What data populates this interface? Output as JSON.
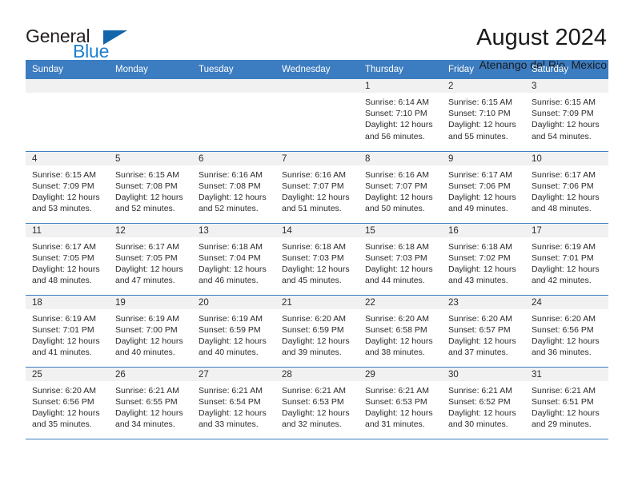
{
  "brand": {
    "name_part1": "General",
    "name_part2": "Blue",
    "triangle_icon": "brand-triangle-icon"
  },
  "header": {
    "title": "August 2024",
    "subtitle": "Atenango del Rio, Mexico"
  },
  "colors": {
    "header_blue": "#3c7cc0",
    "brand_blue": "#1c7fd1",
    "triangle_blue": "#1165aa",
    "daynum_bg": "#f1f1f1",
    "text": "#2b2b2b"
  },
  "weekdays": [
    "Sunday",
    "Monday",
    "Tuesday",
    "Wednesday",
    "Thursday",
    "Friday",
    "Saturday"
  ],
  "weeks": [
    [
      {
        "day": "",
        "empty": true,
        "sunrise": "",
        "sunset": "",
        "daylight": ""
      },
      {
        "day": "",
        "empty": true,
        "sunrise": "",
        "sunset": "",
        "daylight": ""
      },
      {
        "day": "",
        "empty": true,
        "sunrise": "",
        "sunset": "",
        "daylight": ""
      },
      {
        "day": "",
        "empty": true,
        "sunrise": "",
        "sunset": "",
        "daylight": ""
      },
      {
        "day": "1",
        "sunrise": "Sunrise: 6:14 AM",
        "sunset": "Sunset: 7:10 PM",
        "daylight": "Daylight: 12 hours and 56 minutes."
      },
      {
        "day": "2",
        "sunrise": "Sunrise: 6:15 AM",
        "sunset": "Sunset: 7:10 PM",
        "daylight": "Daylight: 12 hours and 55 minutes."
      },
      {
        "day": "3",
        "sunrise": "Sunrise: 6:15 AM",
        "sunset": "Sunset: 7:09 PM",
        "daylight": "Daylight: 12 hours and 54 minutes."
      }
    ],
    [
      {
        "day": "4",
        "sunrise": "Sunrise: 6:15 AM",
        "sunset": "Sunset: 7:09 PM",
        "daylight": "Daylight: 12 hours and 53 minutes."
      },
      {
        "day": "5",
        "sunrise": "Sunrise: 6:15 AM",
        "sunset": "Sunset: 7:08 PM",
        "daylight": "Daylight: 12 hours and 52 minutes."
      },
      {
        "day": "6",
        "sunrise": "Sunrise: 6:16 AM",
        "sunset": "Sunset: 7:08 PM",
        "daylight": "Daylight: 12 hours and 52 minutes."
      },
      {
        "day": "7",
        "sunrise": "Sunrise: 6:16 AM",
        "sunset": "Sunset: 7:07 PM",
        "daylight": "Daylight: 12 hours and 51 minutes."
      },
      {
        "day": "8",
        "sunrise": "Sunrise: 6:16 AM",
        "sunset": "Sunset: 7:07 PM",
        "daylight": "Daylight: 12 hours and 50 minutes."
      },
      {
        "day": "9",
        "sunrise": "Sunrise: 6:17 AM",
        "sunset": "Sunset: 7:06 PM",
        "daylight": "Daylight: 12 hours and 49 minutes."
      },
      {
        "day": "10",
        "sunrise": "Sunrise: 6:17 AM",
        "sunset": "Sunset: 7:06 PM",
        "daylight": "Daylight: 12 hours and 48 minutes."
      }
    ],
    [
      {
        "day": "11",
        "sunrise": "Sunrise: 6:17 AM",
        "sunset": "Sunset: 7:05 PM",
        "daylight": "Daylight: 12 hours and 48 minutes."
      },
      {
        "day": "12",
        "sunrise": "Sunrise: 6:17 AM",
        "sunset": "Sunset: 7:05 PM",
        "daylight": "Daylight: 12 hours and 47 minutes."
      },
      {
        "day": "13",
        "sunrise": "Sunrise: 6:18 AM",
        "sunset": "Sunset: 7:04 PM",
        "daylight": "Daylight: 12 hours and 46 minutes."
      },
      {
        "day": "14",
        "sunrise": "Sunrise: 6:18 AM",
        "sunset": "Sunset: 7:03 PM",
        "daylight": "Daylight: 12 hours and 45 minutes."
      },
      {
        "day": "15",
        "sunrise": "Sunrise: 6:18 AM",
        "sunset": "Sunset: 7:03 PM",
        "daylight": "Daylight: 12 hours and 44 minutes."
      },
      {
        "day": "16",
        "sunrise": "Sunrise: 6:18 AM",
        "sunset": "Sunset: 7:02 PM",
        "daylight": "Daylight: 12 hours and 43 minutes."
      },
      {
        "day": "17",
        "sunrise": "Sunrise: 6:19 AM",
        "sunset": "Sunset: 7:01 PM",
        "daylight": "Daylight: 12 hours and 42 minutes."
      }
    ],
    [
      {
        "day": "18",
        "sunrise": "Sunrise: 6:19 AM",
        "sunset": "Sunset: 7:01 PM",
        "daylight": "Daylight: 12 hours and 41 minutes."
      },
      {
        "day": "19",
        "sunrise": "Sunrise: 6:19 AM",
        "sunset": "Sunset: 7:00 PM",
        "daylight": "Daylight: 12 hours and 40 minutes."
      },
      {
        "day": "20",
        "sunrise": "Sunrise: 6:19 AM",
        "sunset": "Sunset: 6:59 PM",
        "daylight": "Daylight: 12 hours and 40 minutes."
      },
      {
        "day": "21",
        "sunrise": "Sunrise: 6:20 AM",
        "sunset": "Sunset: 6:59 PM",
        "daylight": "Daylight: 12 hours and 39 minutes."
      },
      {
        "day": "22",
        "sunrise": "Sunrise: 6:20 AM",
        "sunset": "Sunset: 6:58 PM",
        "daylight": "Daylight: 12 hours and 38 minutes."
      },
      {
        "day": "23",
        "sunrise": "Sunrise: 6:20 AM",
        "sunset": "Sunset: 6:57 PM",
        "daylight": "Daylight: 12 hours and 37 minutes."
      },
      {
        "day": "24",
        "sunrise": "Sunrise: 6:20 AM",
        "sunset": "Sunset: 6:56 PM",
        "daylight": "Daylight: 12 hours and 36 minutes."
      }
    ],
    [
      {
        "day": "25",
        "sunrise": "Sunrise: 6:20 AM",
        "sunset": "Sunset: 6:56 PM",
        "daylight": "Daylight: 12 hours and 35 minutes."
      },
      {
        "day": "26",
        "sunrise": "Sunrise: 6:21 AM",
        "sunset": "Sunset: 6:55 PM",
        "daylight": "Daylight: 12 hours and 34 minutes."
      },
      {
        "day": "27",
        "sunrise": "Sunrise: 6:21 AM",
        "sunset": "Sunset: 6:54 PM",
        "daylight": "Daylight: 12 hours and 33 minutes."
      },
      {
        "day": "28",
        "sunrise": "Sunrise: 6:21 AM",
        "sunset": "Sunset: 6:53 PM",
        "daylight": "Daylight: 12 hours and 32 minutes."
      },
      {
        "day": "29",
        "sunrise": "Sunrise: 6:21 AM",
        "sunset": "Sunset: 6:53 PM",
        "daylight": "Daylight: 12 hours and 31 minutes."
      },
      {
        "day": "30",
        "sunrise": "Sunrise: 6:21 AM",
        "sunset": "Sunset: 6:52 PM",
        "daylight": "Daylight: 12 hours and 30 minutes."
      },
      {
        "day": "31",
        "sunrise": "Sunrise: 6:21 AM",
        "sunset": "Sunset: 6:51 PM",
        "daylight": "Daylight: 12 hours and 29 minutes."
      }
    ]
  ]
}
